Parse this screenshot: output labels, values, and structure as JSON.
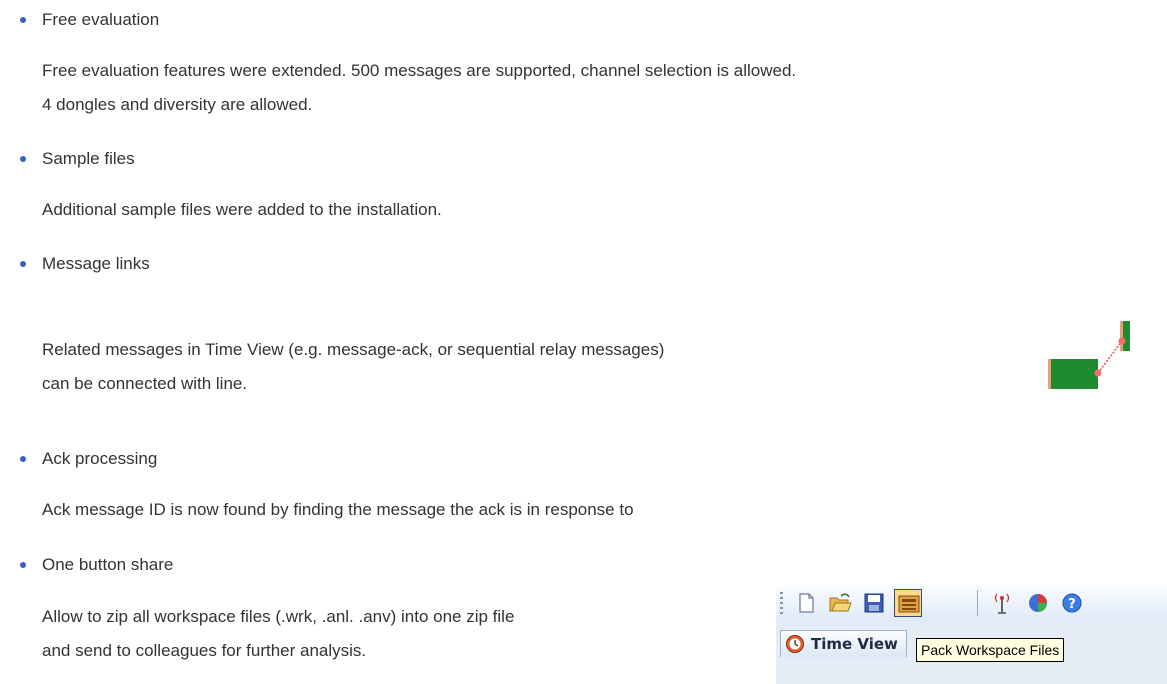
{
  "sections": [
    {
      "title": "Free evaluation",
      "lines": [
        "Free evaluation features were extended. 500 messages are supported, channel selection is allowed.",
        "4 dongles and diversity are allowed."
      ]
    },
    {
      "title": "Sample files",
      "lines": [
        "Additional sample files were added to the installation."
      ]
    },
    {
      "title": "Message links",
      "lines": [
        "Related messages in Time View (e.g. message-ack, or sequential relay messages)",
        "can be connected with line."
      ]
    },
    {
      "title": "Ack processing",
      "lines": [
        "Ack message ID is now found by finding the message the ack is in response to"
      ]
    },
    {
      "title": "One button share",
      "lines": [
        "Allow to zip all workspace files (.wrk, .anl. .anv) into one zip file",
        "and send to colleagues for further analysis."
      ]
    }
  ],
  "toolbar_figure": {
    "buttons": [
      "new-file-icon",
      "open-folder-icon",
      "save-icon",
      "pack-workspace-icon",
      "antenna-icon",
      "pie-chart-icon",
      "help-icon"
    ],
    "tab_label": "Time View",
    "tooltip": "Pack Workspace Files"
  },
  "colors": {
    "bullet": "#3a5fc8",
    "text": "#333333",
    "message_block": "#1e8c2e",
    "link_line": "#e05050",
    "tooltip_bg": "#ffffe1"
  }
}
